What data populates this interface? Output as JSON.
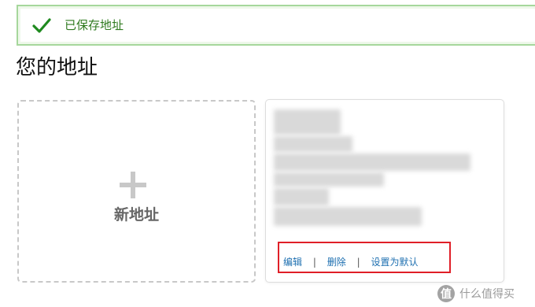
{
  "alert": {
    "message": "已保存地址",
    "icon": "check-icon",
    "color": "#2f7a1f"
  },
  "page": {
    "title": "您的地址"
  },
  "add_card": {
    "icon": "plus-icon",
    "label": "新地址"
  },
  "address_card": {
    "actions": {
      "edit": "编辑",
      "delete": "删除",
      "set_default": "设置为默认",
      "separator": "|"
    },
    "highlight_color": "#e01f27",
    "link_color": "#1d6fb0"
  },
  "watermark": {
    "logo_char": "值",
    "text": "什么值得买"
  }
}
